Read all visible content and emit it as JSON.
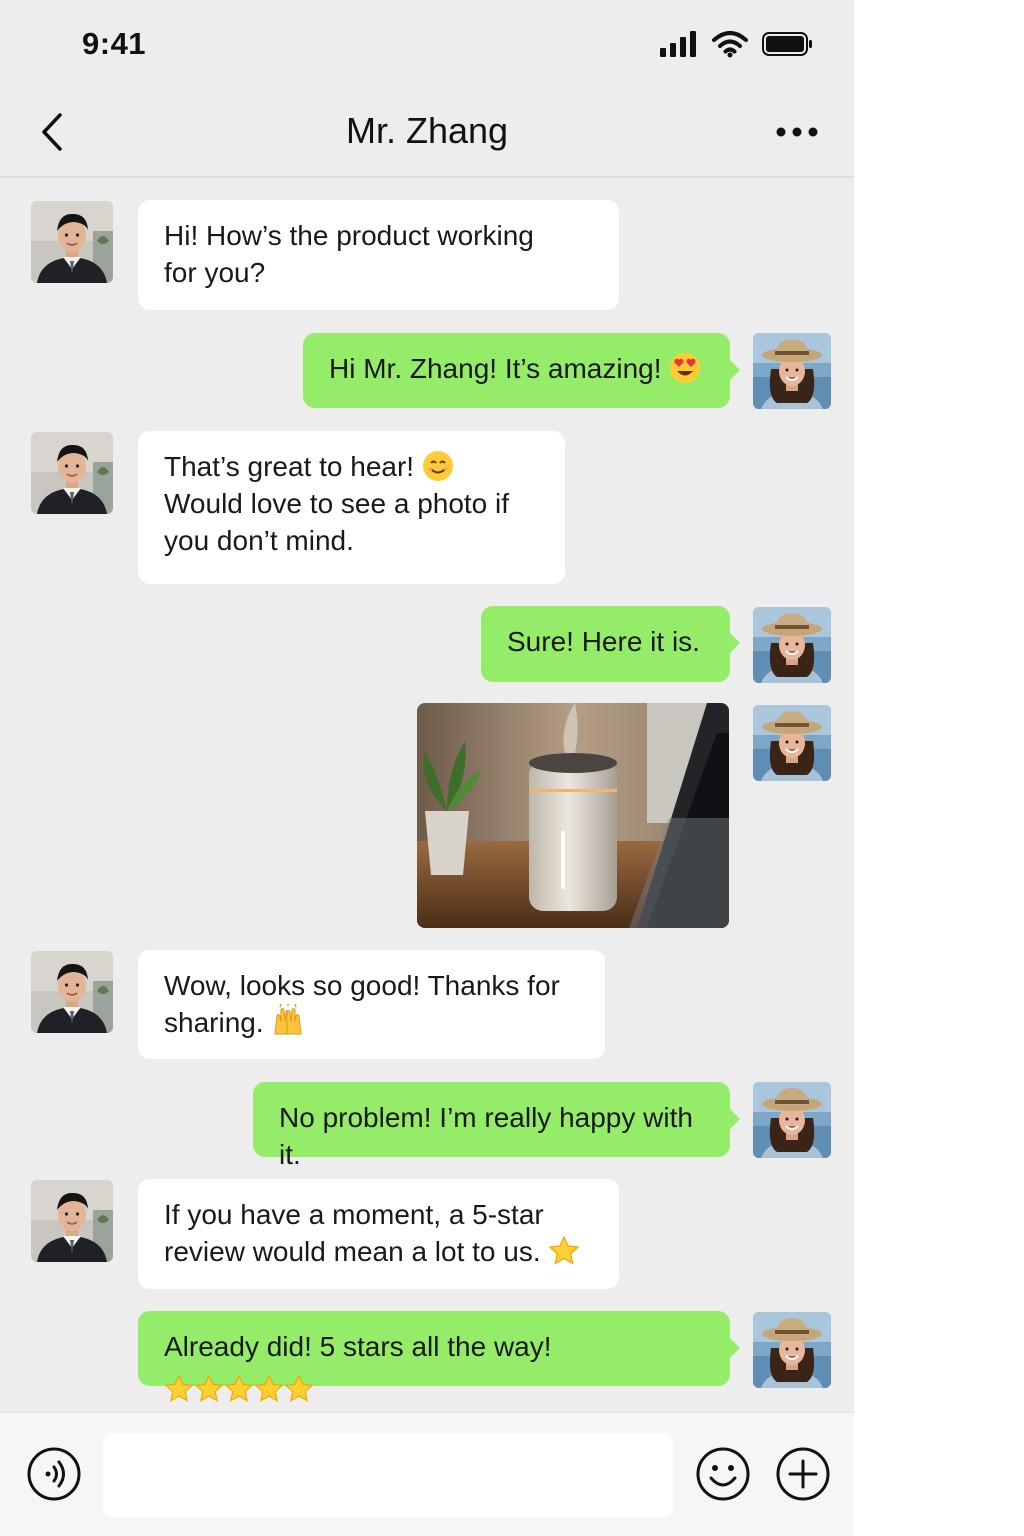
{
  "status_bar": {
    "time": "9:41",
    "icons": [
      "cellular-signal-icon",
      "wifi-icon",
      "battery-icon"
    ]
  },
  "nav": {
    "title": "Mr. Zhang",
    "back_icon": "chevron-left-icon",
    "more_icon": "more-dots-icon"
  },
  "colors": {
    "background": "#ededed",
    "incoming_bubble": "#ffffff",
    "outgoing_bubble": "#95ec69"
  },
  "messages": [
    {
      "sender": "Mr. Zhang",
      "direction": "incoming",
      "lines": [
        "Hi! How’s the product working",
        "for you?"
      ]
    },
    {
      "sender": "me",
      "direction": "outgoing",
      "lines": [
        "Hi Mr. Zhang! It’s amazing!"
      ],
      "emoji": "heart-eyes-emoji-icon"
    },
    {
      "sender": "Mr. Zhang",
      "direction": "incoming",
      "lines": [
        "That’s great to hear!",
        "Would love to see a photo if",
        "you don’t mind."
      ],
      "emoji": "smiling-face-emoji-icon"
    },
    {
      "sender": "me",
      "direction": "outgoing",
      "lines": [
        "Sure! Here it is."
      ]
    },
    {
      "sender": "me",
      "direction": "outgoing",
      "type": "image",
      "image": "humidifier-photo"
    },
    {
      "sender": "Mr. Zhang",
      "direction": "incoming",
      "lines": [
        "Wow, looks so good! Thanks for",
        "sharing."
      ],
      "emoji": "raised-hands-emoji-icon"
    },
    {
      "sender": "me",
      "direction": "outgoing",
      "lines": [
        "No problem! I’m really happy with it."
      ]
    },
    {
      "sender": "Mr. Zhang",
      "direction": "incoming",
      "lines": [
        "If you have a moment, a 5-star",
        "review would mean a lot to us."
      ],
      "emoji": "star-emoji-icon"
    },
    {
      "sender": "me",
      "direction": "outgoing",
      "lines": [
        "Already did! 5 stars all the way!"
      ],
      "emoji": "star-emoji-icon",
      "star_count": 5
    }
  ],
  "input_bar": {
    "placeholder": "",
    "voice_icon": "voice-icon",
    "emoji_icon": "emoji-icon",
    "plus_icon": "plus-icon"
  }
}
